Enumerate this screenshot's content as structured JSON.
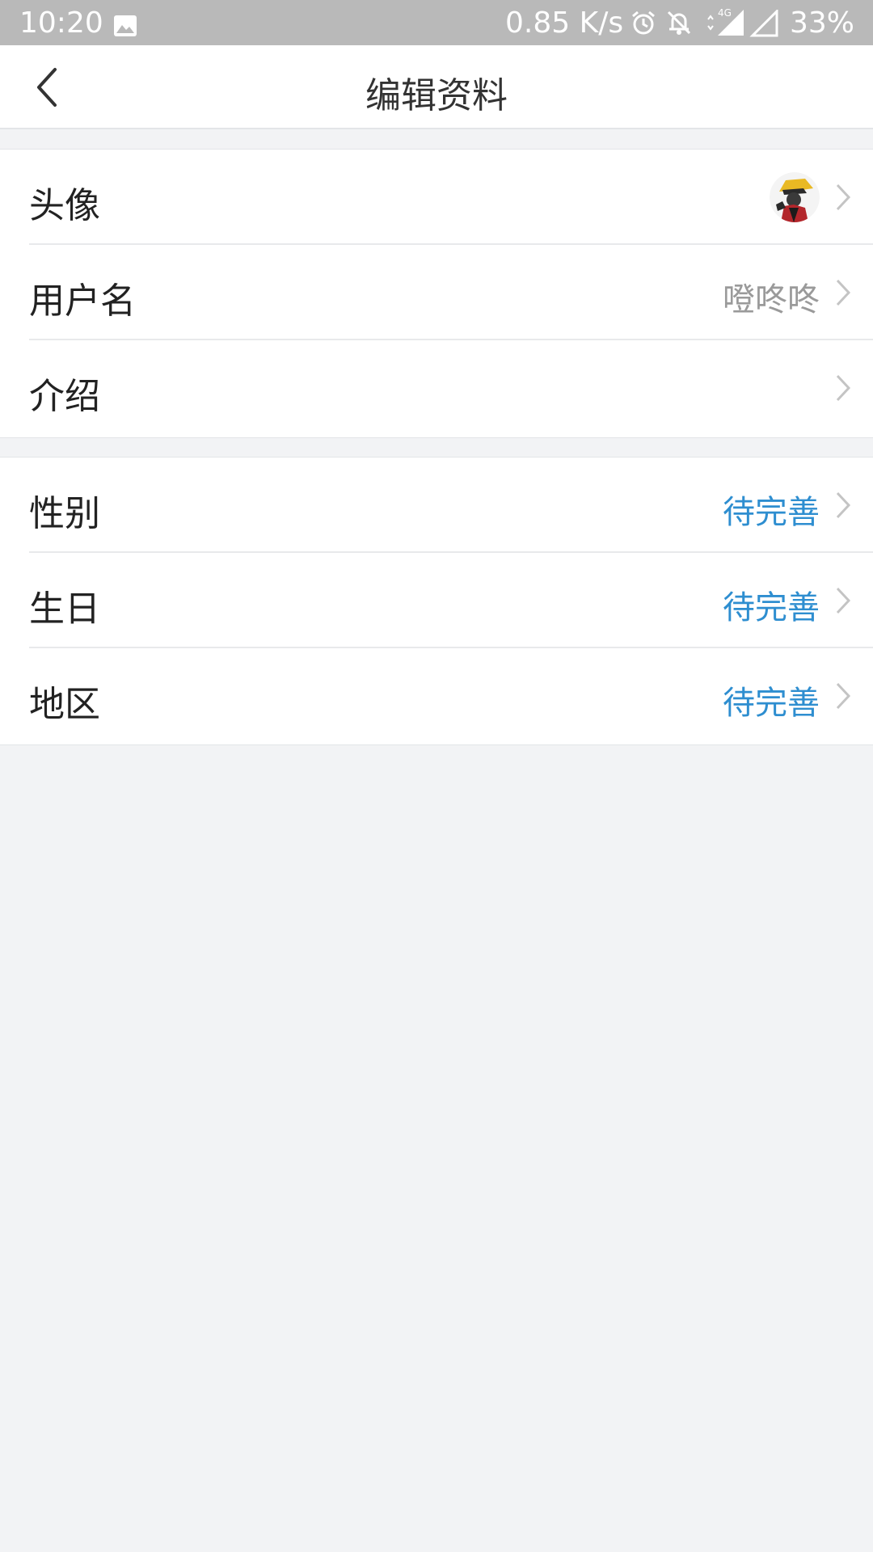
{
  "status_bar": {
    "time": "10:20",
    "network_speed": "0.85 K/s",
    "network_type": "4G",
    "battery": "33%",
    "icons": [
      "image-icon",
      "alarm-icon",
      "bell-off-icon",
      "signal-icon"
    ]
  },
  "header": {
    "title": "编辑资料",
    "back_icon": "chevron-left-icon"
  },
  "profile": {
    "groups": [
      {
        "rows": [
          {
            "label": "头像",
            "type": "avatar"
          },
          {
            "label": "用户名",
            "value": "噔咚咚"
          },
          {
            "label": "介绍",
            "value": ""
          }
        ]
      },
      {
        "rows": [
          {
            "label": "性别",
            "value": "待完善"
          },
          {
            "label": "生日",
            "value": "待完善"
          },
          {
            "label": "地区",
            "value": "待完善"
          }
        ]
      }
    ]
  },
  "colors": {
    "accent": "#2e8ed0",
    "status_bar": "#b9b9b9",
    "background": "#f2f3f5"
  }
}
